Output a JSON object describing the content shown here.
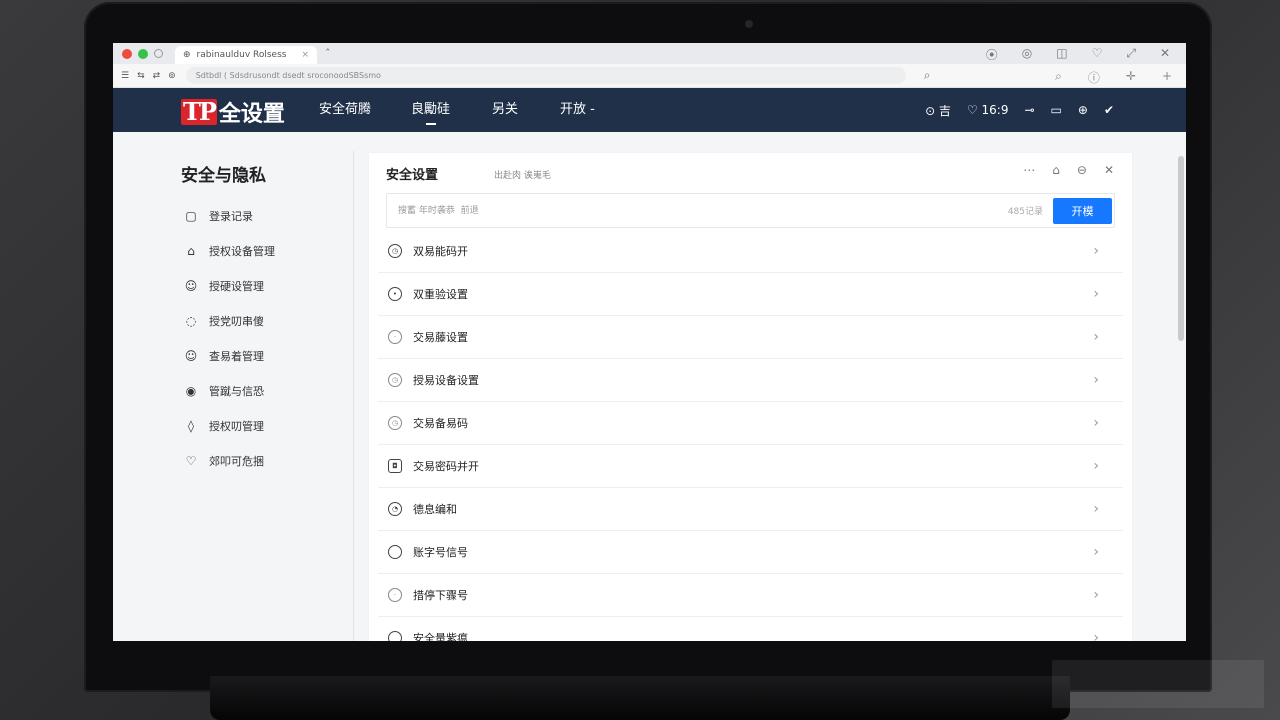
{
  "browser": {
    "tab_title": "rabinaulduv  Rolsess",
    "tab_icon": "page-icon",
    "url": "Sdtbdl ( Sdsdrusondt dsedt sroconoodSBSsmo",
    "icons_right": [
      "minimize-icon",
      "shield-icon",
      "camera-icon",
      "heart-icon",
      "expand-icon",
      "close-icon"
    ]
  },
  "app": {
    "logo_mark": "TP",
    "logo_text": "全设置",
    "nav": [
      "安全荷腾",
      "良勵硅",
      "另关",
      "开放 -"
    ],
    "nav_active": 1,
    "status_left": "⊙ 吉",
    "status_ratio": "♡ 16:9"
  },
  "sidebar": {
    "title": "安全与隐私",
    "items": [
      {
        "label": "登录记录",
        "icon": "▢"
      },
      {
        "label": "授权设备管理",
        "icon": "⌂"
      },
      {
        "label": "授硬设管理",
        "icon": "☺"
      },
      {
        "label": "授党叨串傻",
        "icon": "◌"
      },
      {
        "label": "查易着管理",
        "icon": "☺"
      },
      {
        "label": "管蹴与信恐",
        "icon": "◉"
      },
      {
        "label": "授权叨管理",
        "icon": "◊"
      },
      {
        "label": "郊叩可危捆",
        "icon": "♡"
      }
    ]
  },
  "panel": {
    "title": "安全设置",
    "subtitle": "出赴肉  诶嵬毛",
    "search_placeholder": "搜蓄 年时袭恭  前退",
    "search_count": "485记录",
    "search_button": "开模",
    "rows": [
      {
        "label": "双易能码开",
        "icon": "◷",
        "style": "round"
      },
      {
        "label": "双重验设置",
        "icon": "•",
        "style": "round"
      },
      {
        "label": "交易藤设置",
        "icon": "·",
        "style": "round light"
      },
      {
        "label": "授易设备设置",
        "icon": "◷",
        "style": "round light"
      },
      {
        "label": "交易备易码",
        "icon": "◷",
        "style": "round light"
      },
      {
        "label": "交易密码并开",
        "icon": "◘",
        "style": "sq"
      },
      {
        "label": "德息编和",
        "icon": "◔",
        "style": "round"
      },
      {
        "label": "账字号信号",
        "icon": "",
        "style": "round"
      },
      {
        "label": "措停下骤号",
        "icon": "·",
        "style": "round light"
      },
      {
        "label": "安全量紫瘟",
        "icon": "",
        "style": "round"
      }
    ]
  }
}
